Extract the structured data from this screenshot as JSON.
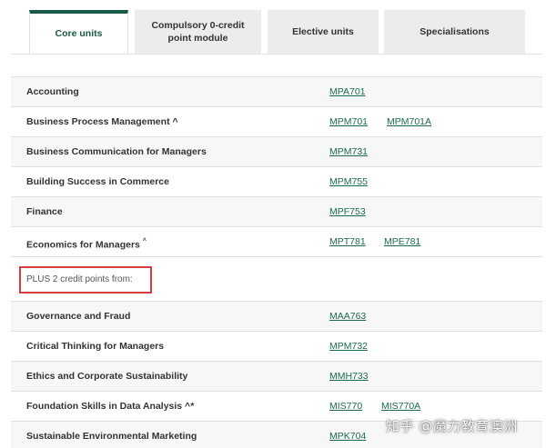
{
  "tabs": [
    {
      "label": "Core units",
      "active": true
    },
    {
      "label": "Compulsory 0-credit point module",
      "active": false
    },
    {
      "label": "Elective units",
      "active": false
    },
    {
      "label": "Specialisations",
      "active": false
    }
  ],
  "rows": [
    {
      "name": "Accounting",
      "mark": "",
      "codes": [
        "MPA701"
      ]
    },
    {
      "name": "Business Process Management ^",
      "mark": "",
      "codes": [
        "MPM701",
        "MPM701A"
      ]
    },
    {
      "name": "Business Communication for Managers",
      "mark": "",
      "codes": [
        "MPM731"
      ]
    },
    {
      "name": "Building Success in Commerce",
      "mark": "",
      "codes": [
        "MPM755"
      ]
    },
    {
      "name": "Finance",
      "mark": "",
      "codes": [
        "MPF753"
      ]
    },
    {
      "name": "Economics for Managers",
      "mark": "^",
      "codes": [
        "MPT781",
        "MPE781"
      ]
    }
  ],
  "plus_text": "PLUS 2 credit points from:",
  "rows2": [
    {
      "name": "Governance and Fraud",
      "mark": "",
      "codes": [
        "MAA763"
      ]
    },
    {
      "name": "Critical Thinking for Managers",
      "mark": "",
      "codes": [
        "MPM732"
      ]
    },
    {
      "name": "Ethics and Corporate Sustainability",
      "mark": "",
      "codes": [
        "MMH733"
      ]
    },
    {
      "name": "Foundation Skills in Data Analysis ^*",
      "mark": "",
      "codes": [
        "MIS770",
        "MIS770A"
      ]
    },
    {
      "name": "Sustainable Environmental Marketing",
      "mark": "",
      "codes": [
        "MPK704"
      ]
    }
  ],
  "watermark": "知乎 @魔力教育澳洲",
  "colors": {
    "accent": "#175a47",
    "link": "#1c6b4d",
    "highlight_box": "#d23f3f"
  }
}
